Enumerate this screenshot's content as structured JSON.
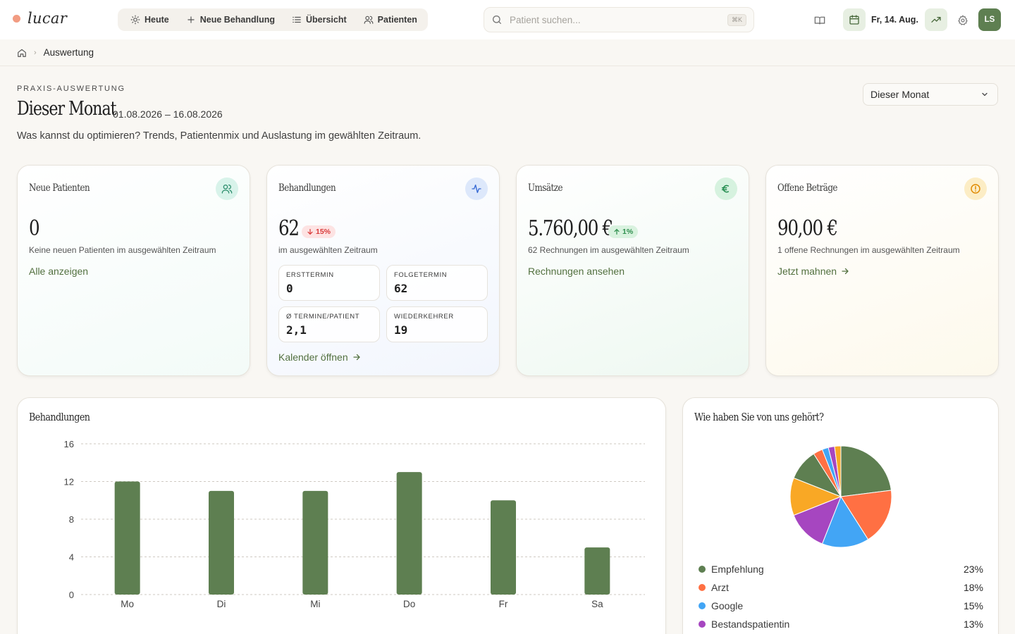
{
  "app": {
    "name": "lucar"
  },
  "nav": {
    "items": [
      {
        "label": "Heute",
        "icon": "sun-icon"
      },
      {
        "label": "Neue Behandlung",
        "icon": "plus-icon"
      },
      {
        "label": "Übersicht",
        "icon": "list-icon"
      },
      {
        "label": "Patienten",
        "icon": "users-icon"
      }
    ]
  },
  "search": {
    "placeholder": "Patient suchen...",
    "shortcut": "⌘K"
  },
  "topbar": {
    "date": "Fr, 14. Aug.",
    "avatar_initials": "LS"
  },
  "breadcrumb": {
    "current": "Auswertung"
  },
  "header": {
    "eyebrow": "PRAXIS-AUSWERTUNG",
    "title": "Dieser Monat",
    "daterange": "01.08.2026 – 16.08.2026",
    "subtitle": "Was kannst du optimieren? Trends, Patientenmix und Auslastung im gewählten Zeitraum.",
    "period_value": "Dieser Monat"
  },
  "cards": {
    "new_patients": {
      "label": "Neue Patienten",
      "value": "0",
      "note": "Keine neuen Patienten im ausgewählten Zeitraum",
      "link": "Alle anzeigen"
    },
    "treatments": {
      "label": "Behandlungen",
      "value": "62",
      "change": "15%",
      "change_direction": "down",
      "note": "im ausgewählten Zeitraum",
      "stats": [
        {
          "label": "ERSTTERMIN",
          "value": "0"
        },
        {
          "label": "FOLGETERMIN",
          "value": "62"
        },
        {
          "label": "Ø TERMINE/PATIENT",
          "value": "2,1"
        },
        {
          "label": "WIEDERKEHRER",
          "value": "19"
        }
      ],
      "link": "Kalender öffnen"
    },
    "revenue": {
      "label": "Umsätze",
      "value": "5.760,00 €",
      "change": "1%",
      "change_direction": "up",
      "note": "62 Rechnungen im ausgewählten Zeitraum",
      "link": "Rechnungen ansehen"
    },
    "open": {
      "label": "Offene Beträge",
      "value": "90,00 €",
      "note": "1 offene Rechnungen im ausgewählten Zeitraum",
      "link": "Jetzt mahnen"
    }
  },
  "colors": {
    "accent_green": "#5e7f51",
    "badge_down": "#d93b3b",
    "badge_up": "#2f8f4e",
    "pie": [
      "#5e7f51",
      "#ff7043",
      "#42a5f5",
      "#a646c0",
      "#f9a825",
      "#5e7f51",
      "#ff7043",
      "#42a5f5",
      "#a646c0",
      "#f9a825"
    ]
  },
  "chart_data": [
    {
      "type": "bar",
      "title": "Behandlungen",
      "categories": [
        "Mo",
        "Di",
        "Mi",
        "Do",
        "Fr",
        "Sa"
      ],
      "values": [
        12,
        11,
        11,
        13,
        10,
        5
      ],
      "yticks": [
        "0",
        "4",
        "8",
        "12",
        "16"
      ],
      "ylim": [
        0,
        16
      ],
      "grid": true
    },
    {
      "type": "pie",
      "title": "Wie haben Sie von uns gehört?",
      "legend": [
        {
          "name": "Empfehlung",
          "pct": "23%"
        },
        {
          "name": "Arzt",
          "pct": "18%"
        },
        {
          "name": "Google",
          "pct": "15%"
        },
        {
          "name": "Bestandspatientin",
          "pct": "13%"
        }
      ],
      "slices": [
        23,
        18,
        15,
        13,
        12,
        10,
        3,
        2,
        2,
        2
      ]
    }
  ]
}
